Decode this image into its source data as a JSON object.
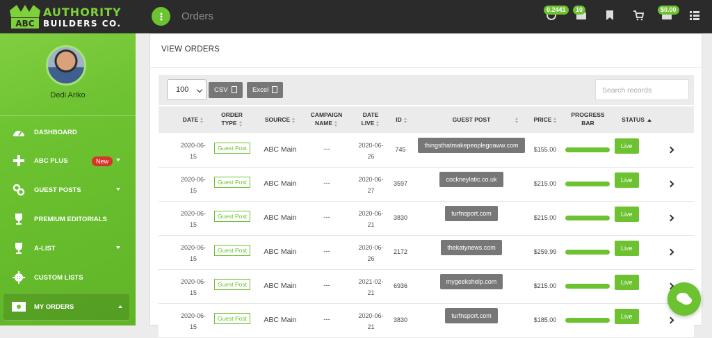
{
  "brand": {
    "line1": "AUTHORITY",
    "line2": "BUILDERS CO.",
    "badge": "ABC"
  },
  "user": {
    "name": "Dedi Ariko"
  },
  "nav": [
    {
      "label": "DASHBOARD",
      "icon": "dashboard-icon"
    },
    {
      "label": "ABC PLUS",
      "icon": "plus-icon",
      "badge": "New"
    },
    {
      "label": "GUEST POSTS",
      "icon": "link-icon"
    },
    {
      "label": "PREMIUM EDITORIALS",
      "icon": "trophy-icon"
    },
    {
      "label": "A-LIST",
      "icon": "trophy-icon"
    },
    {
      "label": "CUSTOM LISTS",
      "icon": "gear-icon"
    },
    {
      "label": "MY ORDERS",
      "icon": "money-icon"
    }
  ],
  "topbar": {
    "title": "Orders",
    "badge1": "0.2441",
    "badge2": "10",
    "badge3": "$0.00"
  },
  "panel": {
    "title": "VIEW ORDERS"
  },
  "controls": {
    "page_size": "100",
    "csv": "CSV",
    "excel": "Excel",
    "search_placeholder": "Search records"
  },
  "columns": {
    "date": "DATE",
    "order_type_1": "ORDER",
    "order_type_2": "TYPE",
    "source": "SOURCE",
    "campaign_1": "CAMPAIGN",
    "campaign_2": "NAME",
    "date_live_1": "DATE",
    "date_live_2": "LIVE",
    "id": "ID",
    "guest_post": "GUEST POST",
    "price": "PRICE",
    "progress_1": "PROGRESS",
    "progress_2": "BAR",
    "status": "STATUS"
  },
  "rows": [
    {
      "date_a": "2020-06-",
      "date_b": "15",
      "type": "Guest Post",
      "source": "ABC Main",
      "campaign": "---",
      "live_a": "2020-06-",
      "live_b": "26",
      "id": "745",
      "guest_post": "thingsthatmakepeoplegoaww.com",
      "price": "$155.00",
      "progress": 1.0,
      "status": "Live"
    },
    {
      "date_a": "2020-06-",
      "date_b": "15",
      "type": "Guest Post",
      "source": "ABC Main",
      "campaign": "---",
      "live_a": "2020-06-",
      "live_b": "27",
      "id": "3597",
      "guest_post": "cockneylatic.co.uk",
      "price": "$215.00",
      "progress": 1.0,
      "status": "Live"
    },
    {
      "date_a": "2020-06-",
      "date_b": "15",
      "type": "Guest Post",
      "source": "ABC Main",
      "campaign": "---",
      "live_a": "2020-06-",
      "live_b": "21",
      "id": "3830",
      "guest_post": "turfnsport.com",
      "price": "$215.00",
      "progress": 1.0,
      "status": "Live"
    },
    {
      "date_a": "2020-06-",
      "date_b": "15",
      "type": "Guest Post",
      "source": "ABC Main",
      "campaign": "---",
      "live_a": "2020-06-",
      "live_b": "26",
      "id": "2172",
      "guest_post": "thekatynews.com",
      "price": "$259.99",
      "progress": 1.0,
      "status": "Live"
    },
    {
      "date_a": "2020-06-",
      "date_b": "15",
      "type": "Guest Post",
      "source": "ABC Main",
      "campaign": "---",
      "live_a": "2021-02-",
      "live_b": "21",
      "id": "6936",
      "guest_post": "mygeekshelp.com",
      "price": "$215.00",
      "progress": 1.0,
      "status": "Live"
    },
    {
      "date_a": "2020-06-",
      "date_b": "15",
      "type": "Guest Post",
      "source": "ABC Main",
      "campaign": "---",
      "live_a": "2020-06-",
      "live_b": "21",
      "id": "3830",
      "guest_post": "turfnsport.com",
      "price": "$185.00",
      "progress": 1.0,
      "status": "Live"
    }
  ],
  "colors": {
    "accent": "#6cc230",
    "dark": "#2b2b2b",
    "pill": "#777777"
  }
}
